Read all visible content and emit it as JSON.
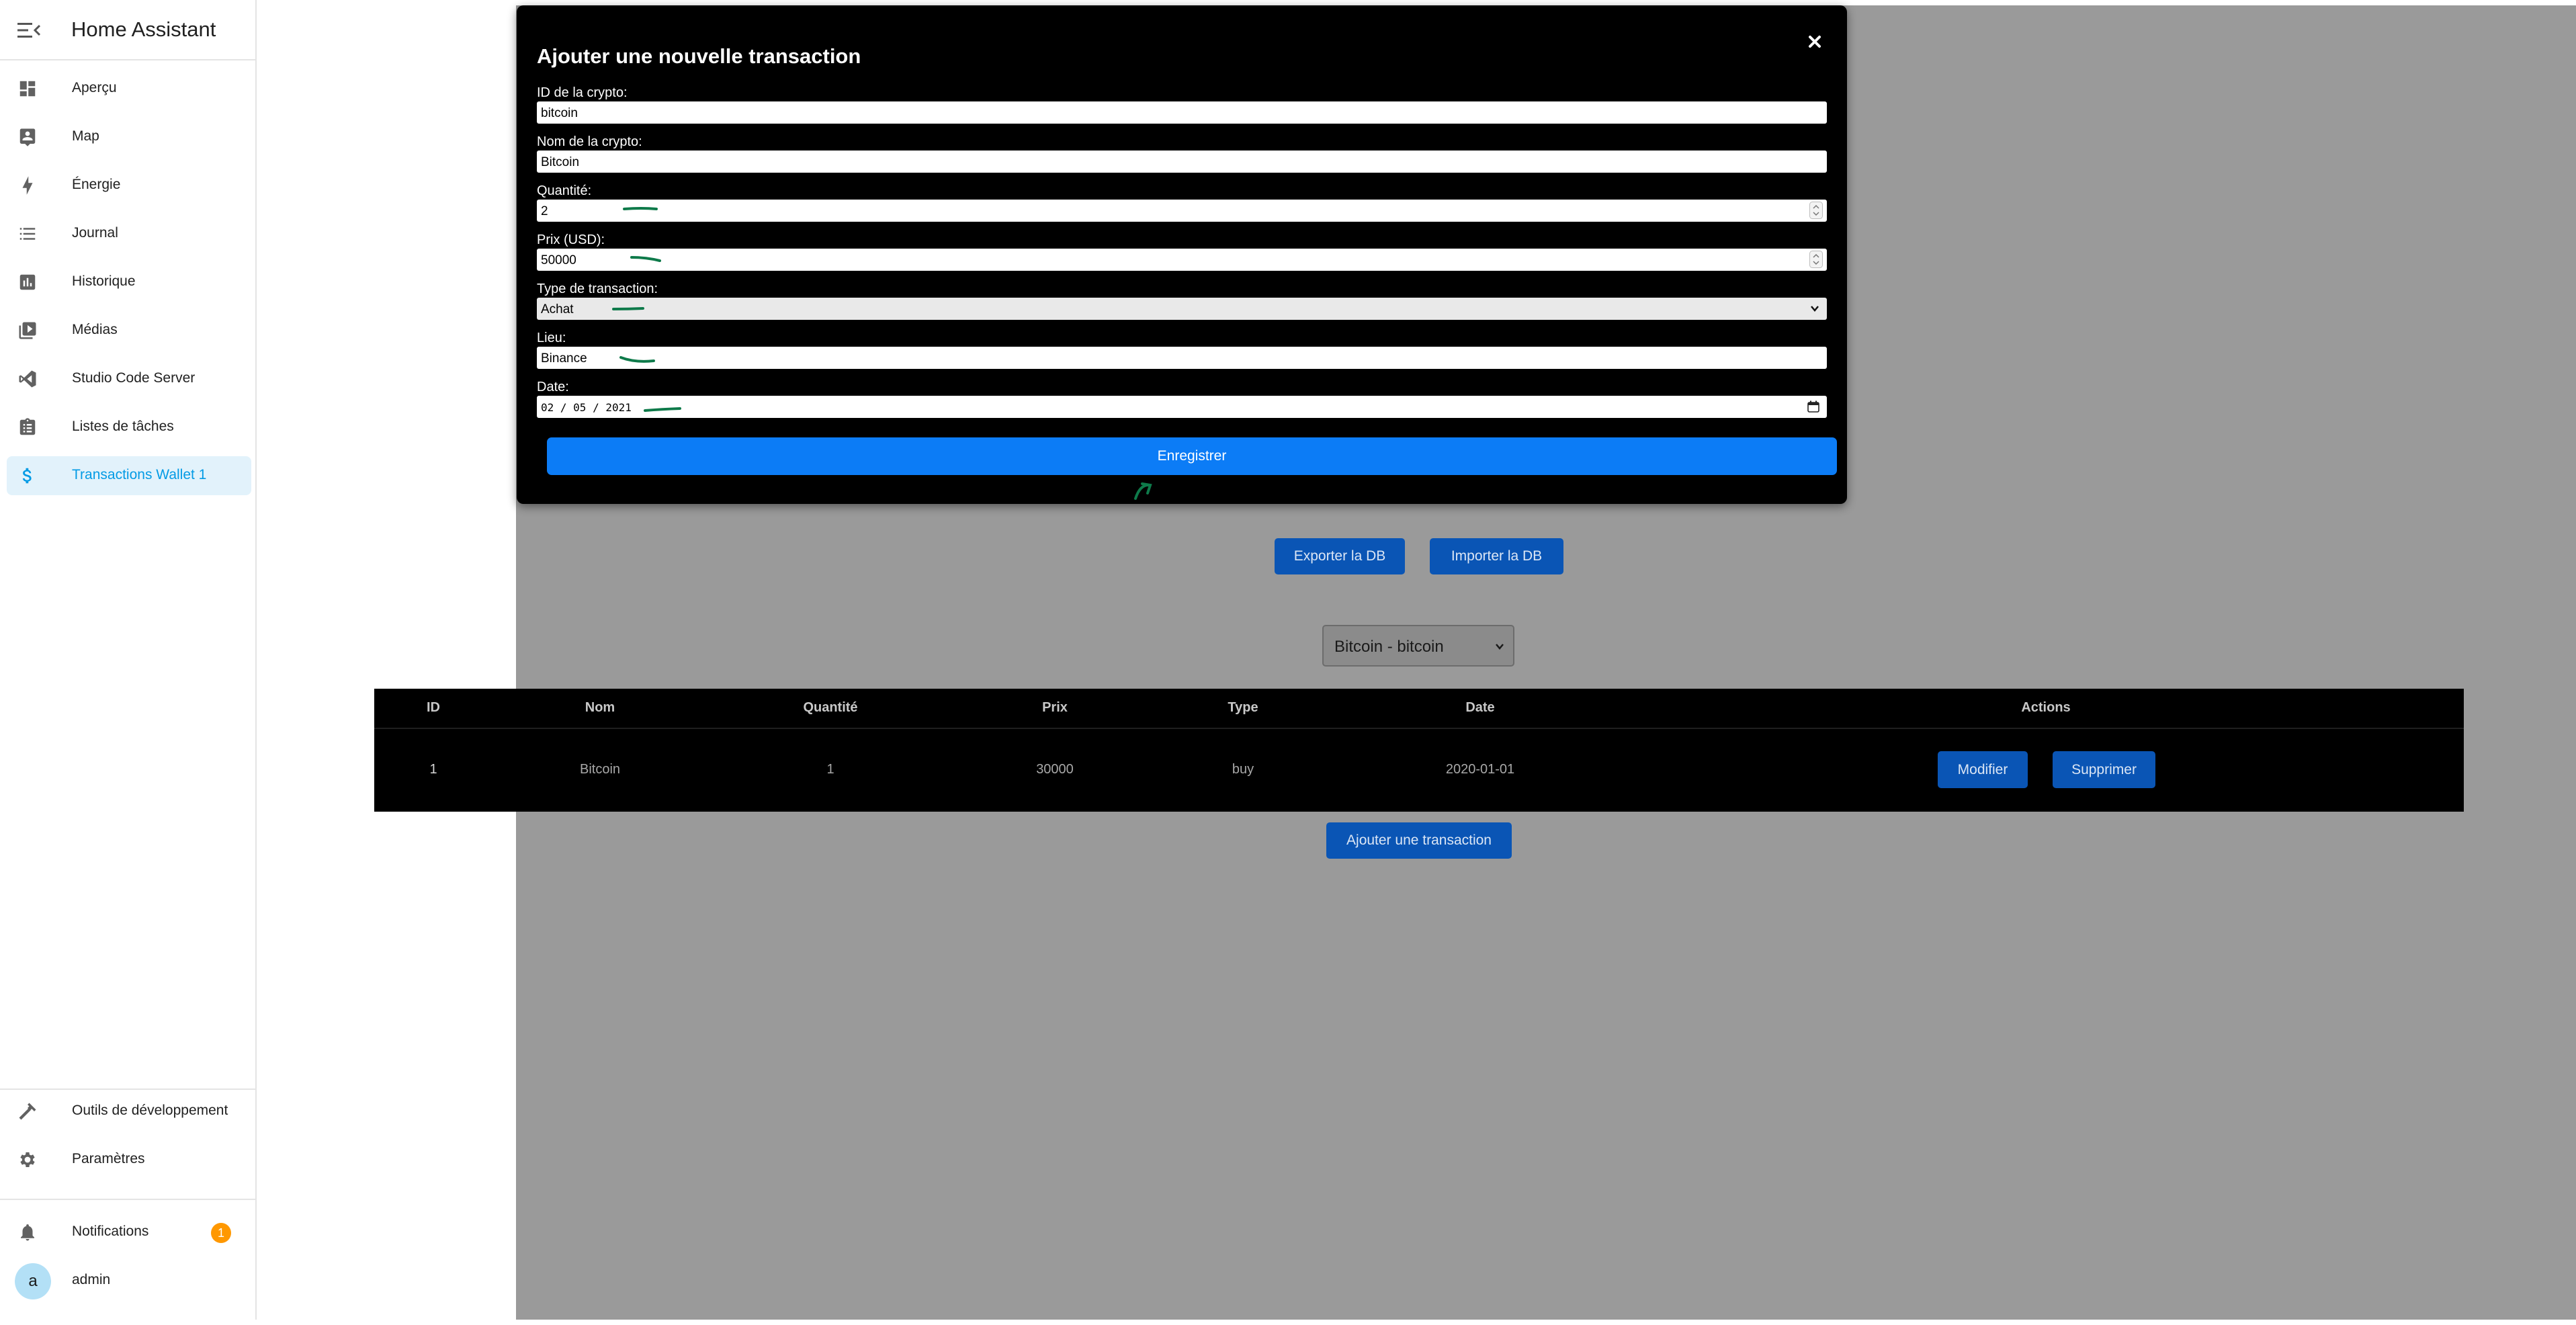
{
  "sidebar": {
    "title": "Home Assistant",
    "items": [
      {
        "label": "Aperçu",
        "icon": "dashboard-icon"
      },
      {
        "label": "Map",
        "icon": "map-icon"
      },
      {
        "label": "Énergie",
        "icon": "lightning-icon"
      },
      {
        "label": "Journal",
        "icon": "list-icon"
      },
      {
        "label": "Historique",
        "icon": "chart-icon"
      },
      {
        "label": "Médias",
        "icon": "media-icon"
      },
      {
        "label": "Studio Code Server",
        "icon": "vscode-icon"
      },
      {
        "label": "Listes de tâches",
        "icon": "clipboard-icon"
      },
      {
        "label": "Transactions Wallet 1",
        "icon": "dollar-icon"
      }
    ],
    "bottom": {
      "dev_tools": "Outils de développement",
      "settings": "Paramètres",
      "notifications": "Notifications",
      "notifications_count": "1",
      "user": "admin",
      "avatar_letter": "a"
    },
    "accent": "#039be5"
  },
  "main": {
    "export_label": "Exporter la DB",
    "import_label": "Importer la DB",
    "crypto_select": "Bitcoin - bitcoin",
    "table": {
      "headers": [
        "ID",
        "Nom",
        "Quantité",
        "Prix",
        "Type",
        "Date",
        "Actions"
      ],
      "rows": [
        {
          "id": "1",
          "nom": "Bitcoin",
          "quantite": "1",
          "prix": "30000",
          "type": "buy",
          "date": "2020-01-01",
          "edit_label": "Modifier",
          "delete_label": "Supprimer"
        }
      ]
    },
    "add_label": "Ajouter une transaction"
  },
  "modal": {
    "title": "Ajouter une nouvelle transaction",
    "fields": {
      "crypto_id_label": "ID de la crypto:",
      "crypto_id_value": "bitcoin",
      "crypto_name_label": "Nom de la crypto:",
      "crypto_name_value": "Bitcoin",
      "quantity_label": "Quantité:",
      "quantity_value": "2",
      "price_label": "Prix (USD):",
      "price_value": "50000",
      "type_label": "Type de transaction:",
      "type_value": "Achat",
      "location_label": "Lieu:",
      "location_value": "Binance",
      "date_label": "Date:",
      "date_value": "02 / 05 / 2021"
    },
    "save_label": "Enregistrer"
  }
}
